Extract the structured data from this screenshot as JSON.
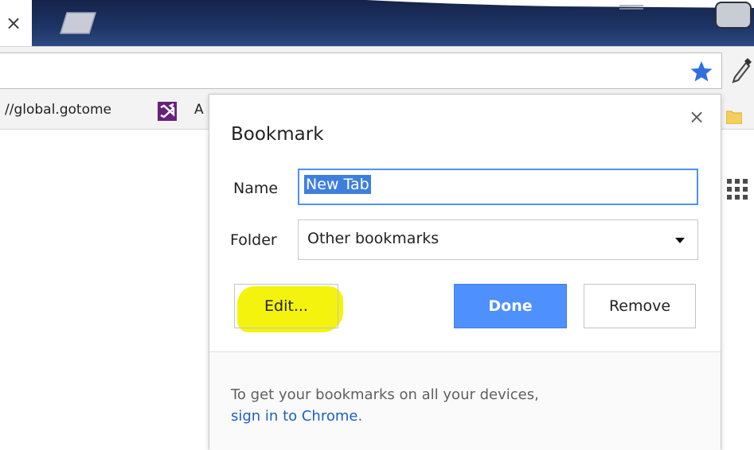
{
  "browser": {
    "tab_close_glyph": "×",
    "bookmarks_bar": {
      "url_text": "//global.gotome",
      "item_a_label": "A"
    }
  },
  "bubble": {
    "title": "Bookmark",
    "close_glyph": "×",
    "name_label": "Name",
    "name_value": "New Tab",
    "folder_label": "Folder",
    "folder_value": "Other bookmarks",
    "edit_label": "Edit...",
    "done_label": "Done",
    "remove_label": "Remove",
    "promo_text": "To get your bookmarks on all your devices,",
    "promo_link": "sign in to Chrome",
    "promo_link_suffix": "."
  },
  "colors": {
    "star": "#2f6fe0",
    "done_button": "#4d90fe",
    "highlight": "#f2f200",
    "frame": "#1c2c52",
    "link": "#1f5fc0"
  },
  "icons": {
    "star": "star-icon",
    "eyedropper": "eyedropper-icon",
    "visual_studio": "vs-icon",
    "folder": "folder-icon",
    "apps": "apps-icon",
    "caret": "caret-icon"
  }
}
